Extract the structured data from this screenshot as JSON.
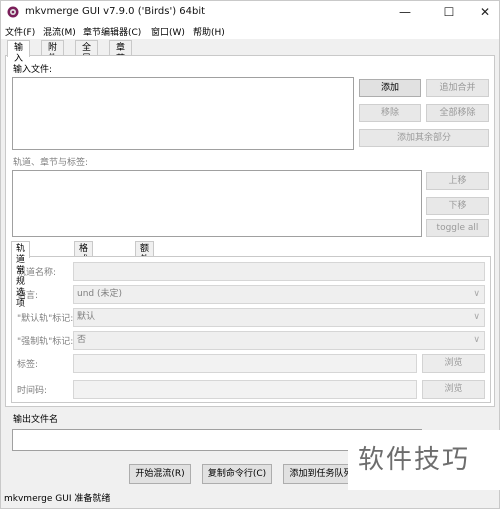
{
  "window": {
    "title": "mkvmerge GUI v7.9.0 ('Birds') 64bit",
    "controls": {
      "minimize": "—",
      "maximize": "☐",
      "close": "✕"
    }
  },
  "menu": [
    "文件(F)",
    "混流(M)",
    "章节编辑器(C)",
    "窗口(W)",
    "帮助(H)"
  ],
  "tabs": [
    "输入",
    "附件",
    "全局",
    "章节编辑器"
  ],
  "input": {
    "files_label": "输入文件:",
    "add": "添加",
    "append": "追加合并",
    "remove": "移除",
    "remove_all": "全部移除",
    "add_other_parts": "添加其余部分",
    "tracks_label": "轨道、章节与标签:",
    "up": "上移",
    "down": "下移",
    "toggle_all": "toggle all"
  },
  "subtabs": [
    "轨道常规选项",
    "格式细节选项",
    "额外选项"
  ],
  "general": {
    "track_name_label": "轨道名称:",
    "language_label": "语言:",
    "language_value": "und (未定)",
    "default_label": "\"默认轨\"标记:",
    "default_value": "默认",
    "forced_label": "\"强制轨\"标记:",
    "forced_value": "否",
    "tags_label": "标签:",
    "timecodes_label": "时间码:",
    "browse": "浏览"
  },
  "output": {
    "label": "输出文件名"
  },
  "actions": {
    "start_mux": "开始混流(R)",
    "copy_cmd": "复制命令行(C)",
    "add_to_queue": "添加到任务队列"
  },
  "status": "mkvmerge GUI 准备就绪",
  "watermark": "软件技巧",
  "colors": {
    "accent": "#0078d7",
    "panel": "#ffffff",
    "chrome": "#f0f0f0"
  }
}
